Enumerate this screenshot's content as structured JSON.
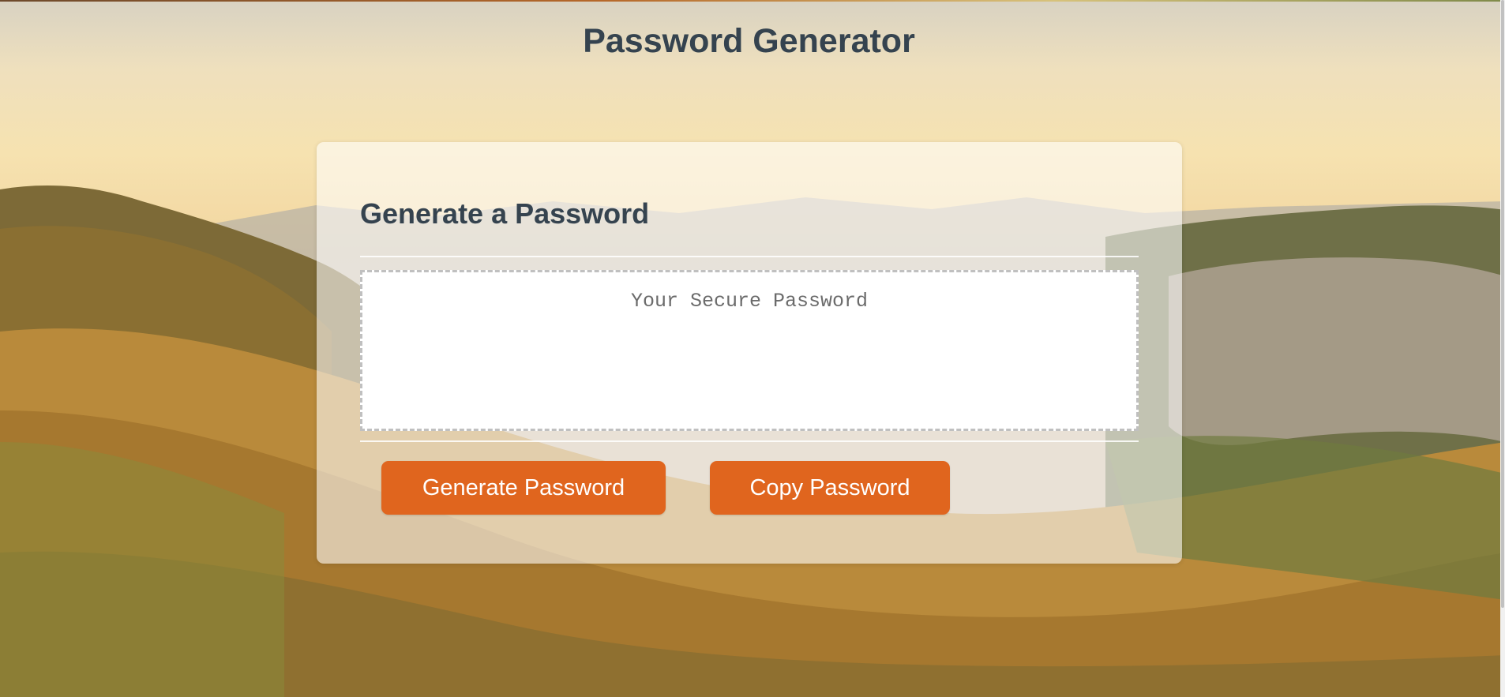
{
  "header": {
    "title": "Password Generator"
  },
  "card": {
    "title": "Generate a Password",
    "password": {
      "value": "",
      "placeholder": "Your Secure Password"
    },
    "buttons": {
      "generate_label": "Generate Password",
      "copy_label": "Copy Password"
    }
  },
  "colors": {
    "accent": "#e0651e",
    "heading": "#35434f"
  }
}
